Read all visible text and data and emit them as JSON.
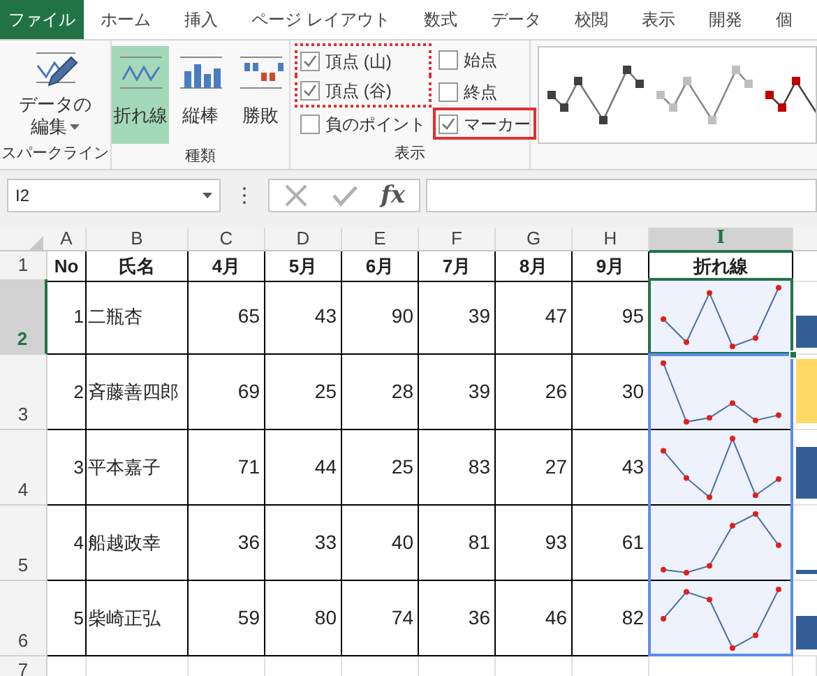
{
  "tabs": [
    {
      "label": "ファイル",
      "kind": "file",
      "selected": false
    },
    {
      "label": "ホーム",
      "kind": "tab",
      "selected": false
    },
    {
      "label": "挿入",
      "kind": "tab",
      "selected": false
    },
    {
      "label": "ページ レイアウト",
      "kind": "tab",
      "selected": false
    },
    {
      "label": "数式",
      "kind": "tab",
      "selected": false
    },
    {
      "label": "データ",
      "kind": "tab",
      "selected": false
    },
    {
      "label": "校閲",
      "kind": "tab",
      "selected": false
    },
    {
      "label": "表示",
      "kind": "tab",
      "selected": false
    },
    {
      "label": "開発",
      "kind": "tab",
      "selected": false
    },
    {
      "label": "個",
      "kind": "tab",
      "selected": false
    }
  ],
  "ribbon": {
    "sparkline_group": {
      "label": "スパークライン",
      "edit_button": {
        "line_1": "データの",
        "line_2": "編集",
        "dropdown": true
      }
    },
    "type_group": {
      "label": "種類",
      "types": [
        {
          "label": "折れ線",
          "kind": "line",
          "selected": true
        },
        {
          "label": "縦棒",
          "kind": "column",
          "selected": false
        },
        {
          "label": "勝敗",
          "kind": "winloss",
          "selected": false
        }
      ]
    },
    "show_group": {
      "label": "表示",
      "columns": [
        [
          {
            "label": "頂点 (山)",
            "checked": true,
            "dotted_frame": true,
            "red_frame": false
          },
          {
            "label": "頂点 (谷)",
            "checked": true,
            "dotted_frame": true,
            "red_frame": false
          },
          {
            "label": "負のポイント",
            "checked": false,
            "dotted_frame": false,
            "red_frame": false
          }
        ],
        [
          {
            "label": "始点",
            "checked": false,
            "dotted_frame": false,
            "red_frame": false
          },
          {
            "label": "終点",
            "checked": false,
            "dotted_frame": false,
            "red_frame": false
          },
          {
            "label": "マーカー",
            "checked": true,
            "dotted_frame": false,
            "red_frame": true
          }
        ]
      ]
    },
    "style_gallery": [
      {
        "color": "#404040"
      },
      {
        "color": "#bfbfbf"
      },
      {
        "color": "#c00000"
      }
    ]
  },
  "formula_bar": {
    "name_box": "I2",
    "fx": "fx"
  },
  "sheet": {
    "columns": [
      {
        "label": "A",
        "selected": false
      },
      {
        "label": "B",
        "selected": false
      },
      {
        "label": "C",
        "selected": false
      },
      {
        "label": "D",
        "selected": false
      },
      {
        "label": "E",
        "selected": false
      },
      {
        "label": "F",
        "selected": false
      },
      {
        "label": "G",
        "selected": false
      },
      {
        "label": "H",
        "selected": false
      },
      {
        "label": "I",
        "selected": true
      }
    ],
    "header_row": {
      "number": "1",
      "cells": [
        "No",
        "氏名",
        "4月",
        "5月",
        "6月",
        "7月",
        "8月",
        "9月",
        "折れ線"
      ]
    },
    "rows": [
      {
        "number": "2",
        "selected": true,
        "no": "1",
        "name": "二瓶杏",
        "values": [
          "65",
          "43",
          "90",
          "39",
          "47",
          "95"
        ],
        "sparkline": {
          "active": true,
          "in_selection": false
        },
        "side_bar": {
          "level": 0.42,
          "color": "#335f96"
        }
      },
      {
        "number": "3",
        "selected": false,
        "no": "2",
        "name": "斉藤善四郎",
        "values": [
          "69",
          "25",
          "28",
          "39",
          "26",
          "30"
        ],
        "sparkline": {
          "active": false,
          "in_selection": true
        },
        "side_bar": {
          "level": 0.85,
          "color": "#ffd966"
        }
      },
      {
        "number": "4",
        "selected": false,
        "no": "3",
        "name": "平本嘉子",
        "values": [
          "71",
          "44",
          "25",
          "83",
          "27",
          "43"
        ],
        "sparkline": {
          "active": false,
          "in_selection": true
        },
        "side_bar": {
          "level": 0.68,
          "color": "#335f96"
        }
      },
      {
        "number": "5",
        "selected": false,
        "no": "4",
        "name": "船越政幸",
        "values": [
          "36",
          "33",
          "40",
          "81",
          "93",
          "61"
        ],
        "sparkline": {
          "active": false,
          "in_selection": true
        },
        "side_bar": {
          "level": 0.05,
          "color": "#335f96"
        }
      },
      {
        "number": "6",
        "selected": false,
        "no": "5",
        "name": "柴崎正弘",
        "values": [
          "59",
          "80",
          "74",
          "36",
          "46",
          "82"
        ],
        "sparkline": {
          "active": false,
          "in_selection": true
        },
        "side_bar": {
          "level": 0.45,
          "color": "#335f96"
        }
      }
    ],
    "empty_rows": [
      "7"
    ]
  }
}
